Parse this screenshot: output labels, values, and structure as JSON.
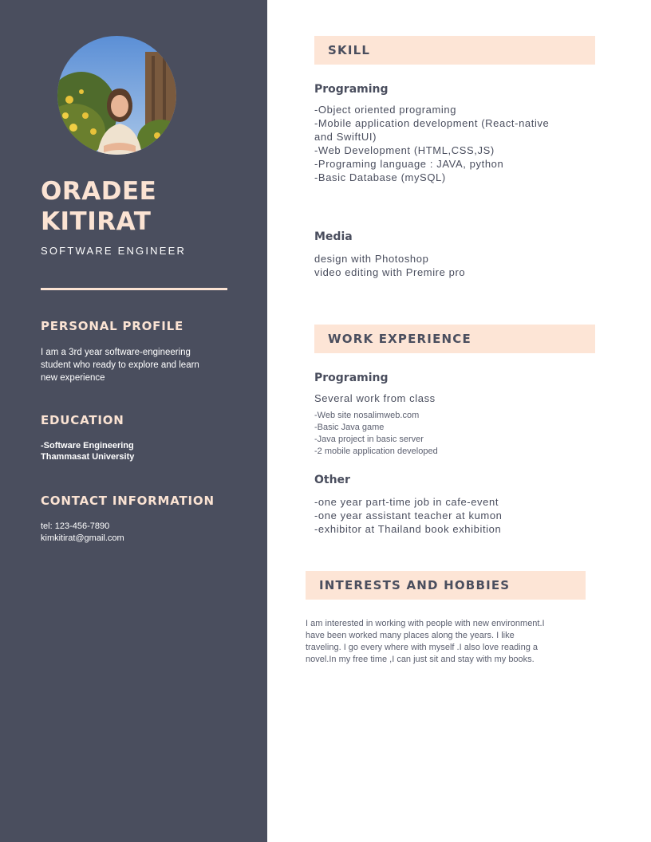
{
  "profile": {
    "name_line1": "ORADEE",
    "name_line2": "KITIRAT",
    "job_title": "SOFTWARE ENGINEER"
  },
  "personal_profile": {
    "heading": "PERSONAL PROFILE",
    "lines": [
      "I am a 3rd year software-engineering",
      "student who ready to explore and learn",
      "new experience"
    ]
  },
  "education": {
    "heading": "EDUCATION",
    "lines": [
      "-Software Engineering",
      "Thammasat University"
    ]
  },
  "contact": {
    "heading": "CONTACT INFORMATION",
    "phone": "tel: 123-456-7890",
    "email": "kimkitirat@gmail.com"
  },
  "skill": {
    "heading": "SKILL",
    "programing": {
      "title": "Programing",
      "lines": [
        "-Object oriented programing",
        "-Mobile application development (React-native",
        "and SwiftUI)",
        "-Web Development (HTML,CSS,JS)",
        "-Programing language : JAVA, python",
        "-Basic Database (mySQL)"
      ]
    },
    "media": {
      "title": "Media",
      "lines": [
        "design with Photoshop",
        "video editing with Premire pro"
      ]
    }
  },
  "work_experience": {
    "heading": "WORK EXPERIENCE",
    "programing": {
      "title": "Programing",
      "subtitle": "Several work from class",
      "lines": [
        "-Web site nosalimweb.com",
        "-Basic Java game",
        "-Java project in basic server",
        "-2 mobile application developed"
      ]
    },
    "other": {
      "title": "Other",
      "lines": [
        "-one year part-time job in cafe-event",
        "-one year assistant teacher at kumon",
        "-exhibitor at Thailand book exhibition"
      ]
    }
  },
  "interests": {
    "heading": "INTERESTS AND HOBBIES",
    "lines": [
      "I am interested in working with people with new environment.I",
      "have been worked  many places along the years. I like",
      "traveling. I go every where with myself .I also love reading a",
      "novel.In my free time ,I can just sit and stay with my books."
    ]
  },
  "colors": {
    "sidebar": "#4a4e5e",
    "accent": "#fbe3d3",
    "band": "#fde5d6",
    "text_dark": "#4a4e5e"
  }
}
